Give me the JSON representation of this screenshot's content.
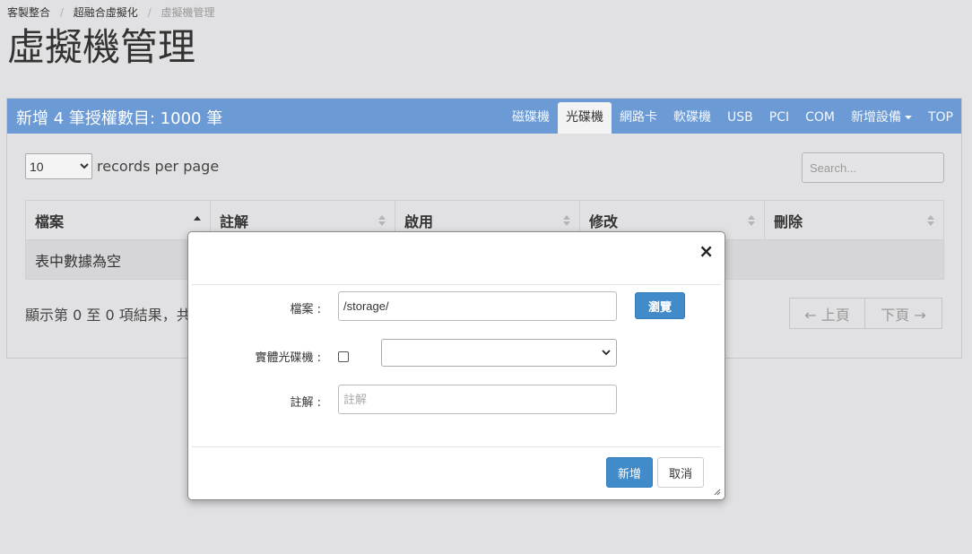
{
  "breadcrumb": [
    "客製整合",
    "超融合虛擬化",
    "虛擬機管理"
  ],
  "page_title": "虛擬機管理",
  "panel": {
    "title": "新增 4 筆授權數目: 1000 筆",
    "tabs": [
      "磁碟機",
      "光碟機",
      "網路卡",
      "軟碟機",
      "USB",
      "PCI",
      "COM",
      "新增設備",
      "TOP"
    ],
    "active_tab": "光碟機"
  },
  "table_controls": {
    "length_value": "10",
    "length_label": "records per page",
    "search_placeholder": "Search..."
  },
  "table": {
    "columns": [
      "檔案",
      "註解",
      "啟用",
      "修改",
      "刪除"
    ],
    "empty_text": "表中數據為空"
  },
  "info_text": "顯示第 0 至 0 項結果，共",
  "pager": {
    "prev": "← 上頁",
    "next": "下頁 →"
  },
  "modal": {
    "file_label": "檔案 :",
    "file_value": "/storage/",
    "browse_button": "瀏覽",
    "physical_label": "實體光碟機 :",
    "note_label": "註解 :",
    "note_placeholder": "註解",
    "add_button": "新增",
    "cancel_button": "取消",
    "close_symbol": "×"
  }
}
